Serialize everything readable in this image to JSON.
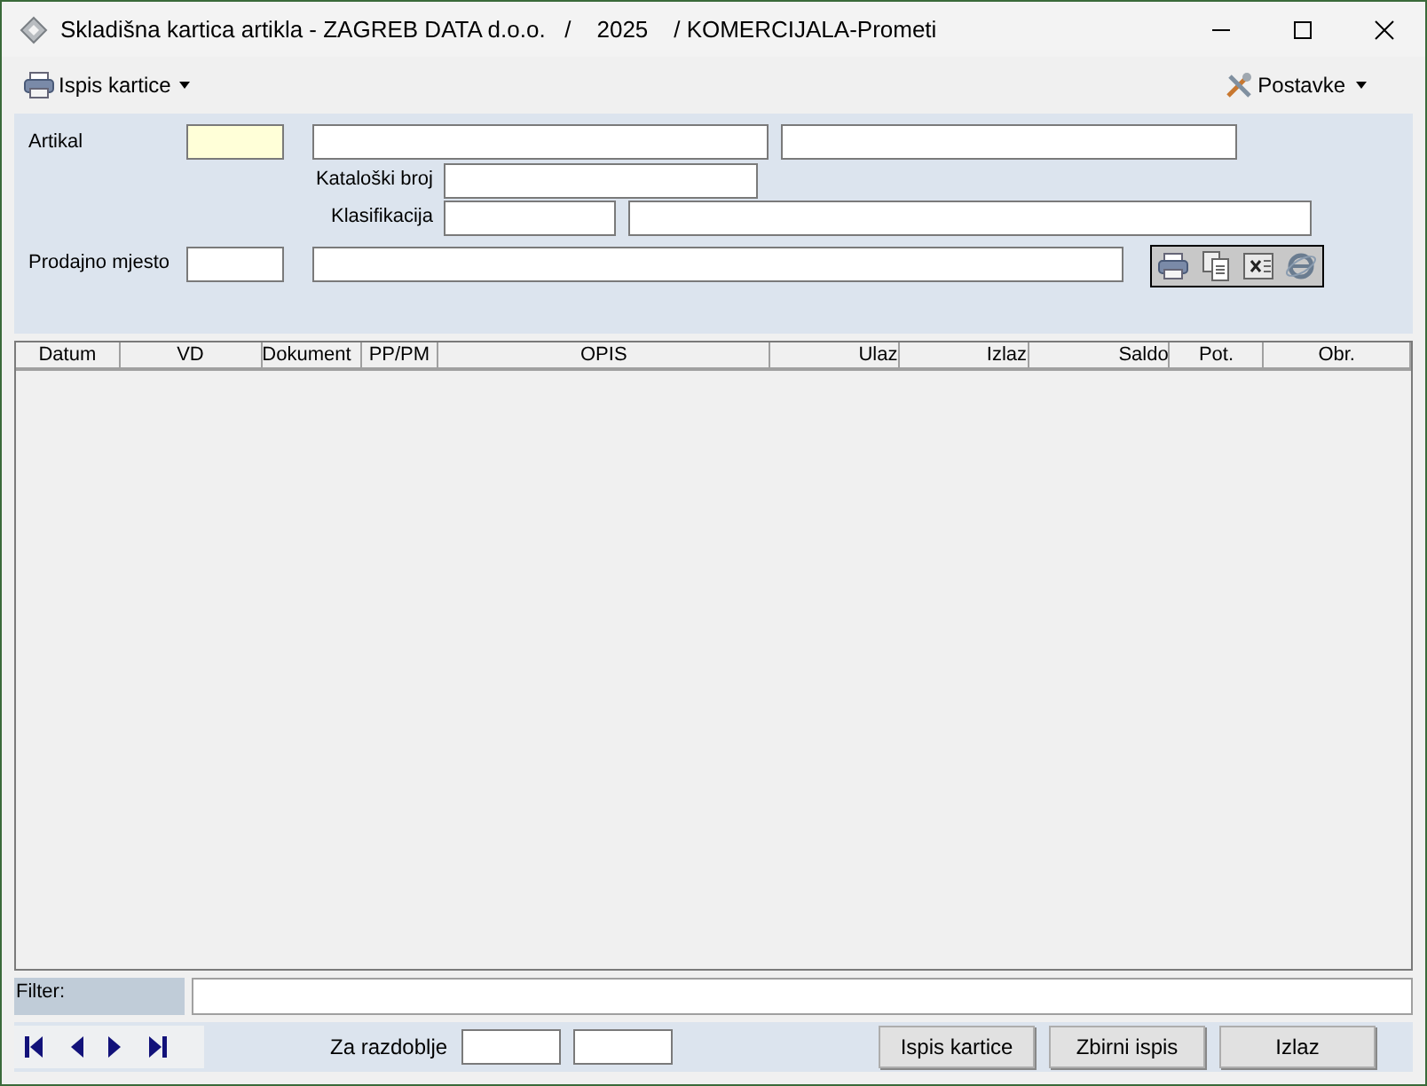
{
  "window": {
    "title": "Skladišna kartica artikla - ZAGREB DATA d.o.o.   /    2025    / KOMERCIJALA-Prometi"
  },
  "toolbar": {
    "print_menu": "Ispis kartice",
    "settings_menu": "Postavke"
  },
  "form": {
    "artikal_label": "Artikal",
    "katalog_label": "Kataloški broj",
    "klasifikacija_label": "Klasifikacija",
    "prodajno_label": "Prodajno mjesto"
  },
  "table": {
    "columns": [
      {
        "label": "Datum"
      },
      {
        "label": "VD"
      },
      {
        "label": "Dokument"
      },
      {
        "label": "PP/PM"
      },
      {
        "label": "OPIS"
      },
      {
        "label": "Ulaz"
      },
      {
        "label": "Izlaz"
      },
      {
        "label": "Saldo"
      },
      {
        "label": "Pot."
      },
      {
        "label": "Obr."
      }
    ]
  },
  "filter": {
    "label": "Filter:"
  },
  "bottom": {
    "period_label": "Za razdoblje",
    "buttons": [
      "Ispis kartice",
      "Zbirni ispis",
      "Izlaz"
    ]
  }
}
